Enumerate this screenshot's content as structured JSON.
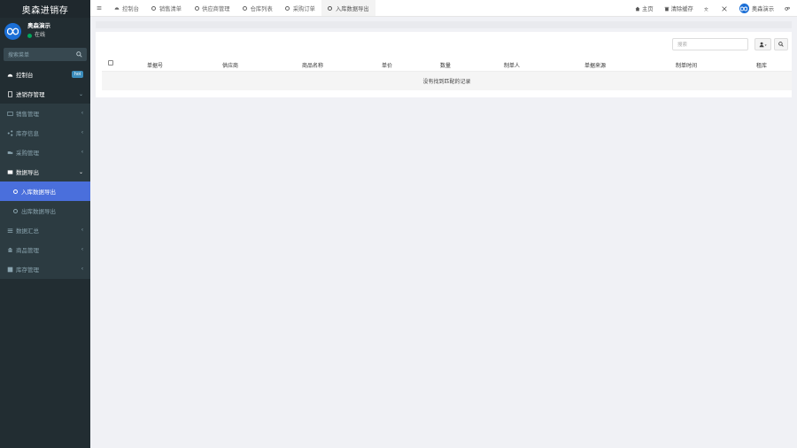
{
  "sidebar": {
    "brand": "奥森进销存",
    "user_name": "奥森演示",
    "user_status": "在线",
    "search_placeholder": "搜索菜单",
    "items": [
      {
        "label": "控制台",
        "badge": "hot"
      },
      {
        "label": "进销存管理"
      },
      {
        "label": "销售管理"
      },
      {
        "label": "库存信息"
      },
      {
        "label": "采购管理"
      },
      {
        "label": "数据导出"
      },
      {
        "label": "入库数据导出"
      },
      {
        "label": "出库数据导出"
      },
      {
        "label": "数据汇总"
      },
      {
        "label": "商品管理"
      },
      {
        "label": "库存管理"
      }
    ]
  },
  "header": {
    "tabs": [
      {
        "label": "控制台",
        "icon": "dashboard-icon"
      },
      {
        "label": "销售清单",
        "icon": "circle-icon"
      },
      {
        "label": "供应商管理",
        "icon": "circle-icon"
      },
      {
        "label": "仓库列表",
        "icon": "circle-icon"
      },
      {
        "label": "采购订单",
        "icon": "circle-icon"
      },
      {
        "label": "入库数据导出",
        "icon": "circle-icon"
      }
    ],
    "right": {
      "home": "主页",
      "clear_cache": "清除缓存",
      "user": "奥森演示"
    }
  },
  "toolbar": {
    "search_placeholder": "搜索"
  },
  "table": {
    "columns": [
      "单据号",
      "供应商",
      "商品名称",
      "单价",
      "数量",
      "制单人",
      "单据来源",
      "制单时间",
      "租库"
    ],
    "empty_text": "没有找到匹配的记录"
  },
  "colors": {
    "sidebar_bg": "#222d32",
    "active_item": "#4a6fdc",
    "avatar": "#1b6fd6",
    "online": "#00a65a"
  }
}
